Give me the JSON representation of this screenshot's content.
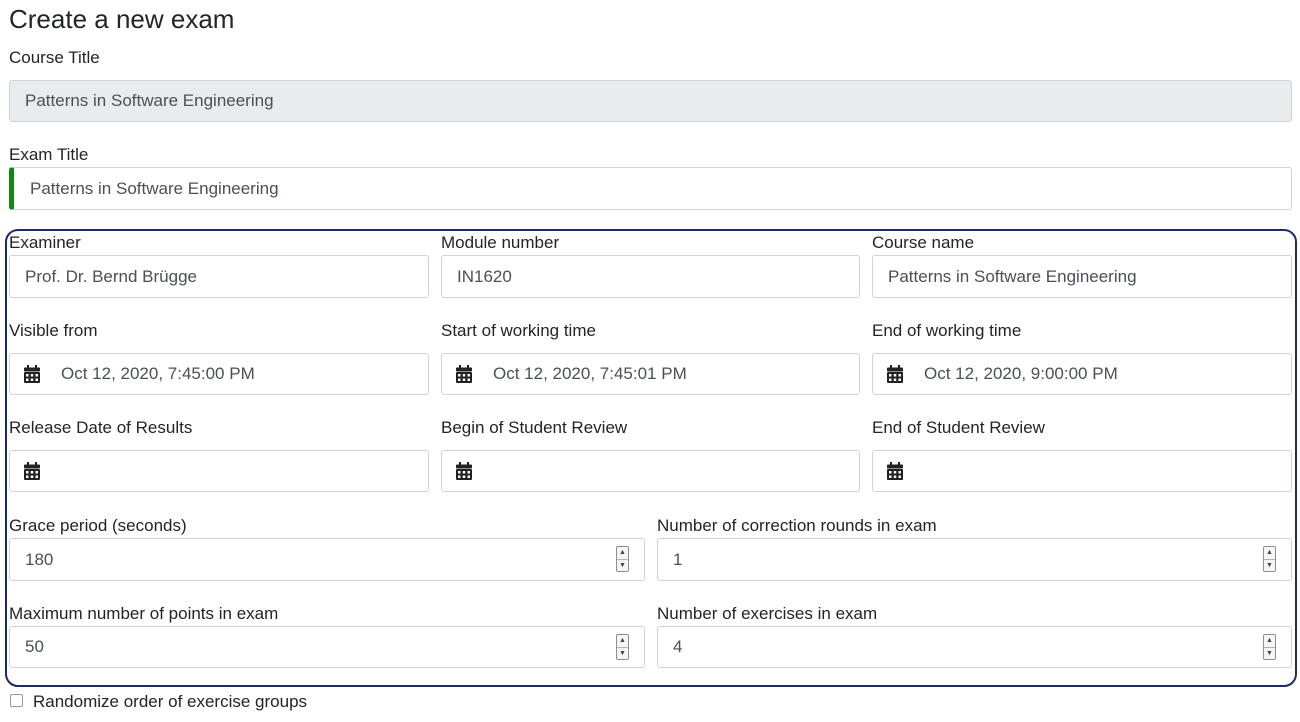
{
  "page": {
    "title": "Create a new exam"
  },
  "course_title": {
    "label": "Course Title",
    "value": "Patterns in Software Engineering"
  },
  "exam_title": {
    "label": "Exam Title",
    "value": "Patterns in Software Engineering"
  },
  "examiner": {
    "label": "Examiner",
    "value": "Prof. Dr. Bernd Brügge"
  },
  "module_number": {
    "label": "Module number",
    "value": "IN1620"
  },
  "course_name": {
    "label": "Course name",
    "value": "Patterns in Software Engineering"
  },
  "visible_from": {
    "label": "Visible from",
    "value": "Oct 12, 2020, 7:45:00 PM",
    "icon": "calendar-icon"
  },
  "start_working_time": {
    "label": "Start of working time",
    "value": "Oct 12, 2020, 7:45:01 PM",
    "icon": "calendar-icon"
  },
  "end_working_time": {
    "label": "End of working time",
    "value": "Oct 12, 2020, 9:00:00 PM",
    "icon": "calendar-icon"
  },
  "release_date_results": {
    "label": "Release Date of Results",
    "value": "",
    "icon": "calendar-icon"
  },
  "begin_student_review": {
    "label": "Begin of Student Review",
    "value": "",
    "icon": "calendar-icon"
  },
  "end_student_review": {
    "label": "End of Student Review",
    "value": "",
    "icon": "calendar-icon"
  },
  "grace_period": {
    "label": "Grace period (seconds)",
    "value": "180"
  },
  "correction_rounds": {
    "label": "Number of correction rounds in exam",
    "value": "1"
  },
  "max_points": {
    "label": "Maximum number of points in exam",
    "value": "50"
  },
  "num_exercises": {
    "label": "Number of exercises in exam",
    "value": "4"
  },
  "randomize": {
    "label": "Randomize order of exercise groups",
    "checked": false
  },
  "colors": {
    "valid_indicator": "#118811",
    "group_border": "#1b2a6b",
    "disabled_bg": "#e9ecef"
  }
}
